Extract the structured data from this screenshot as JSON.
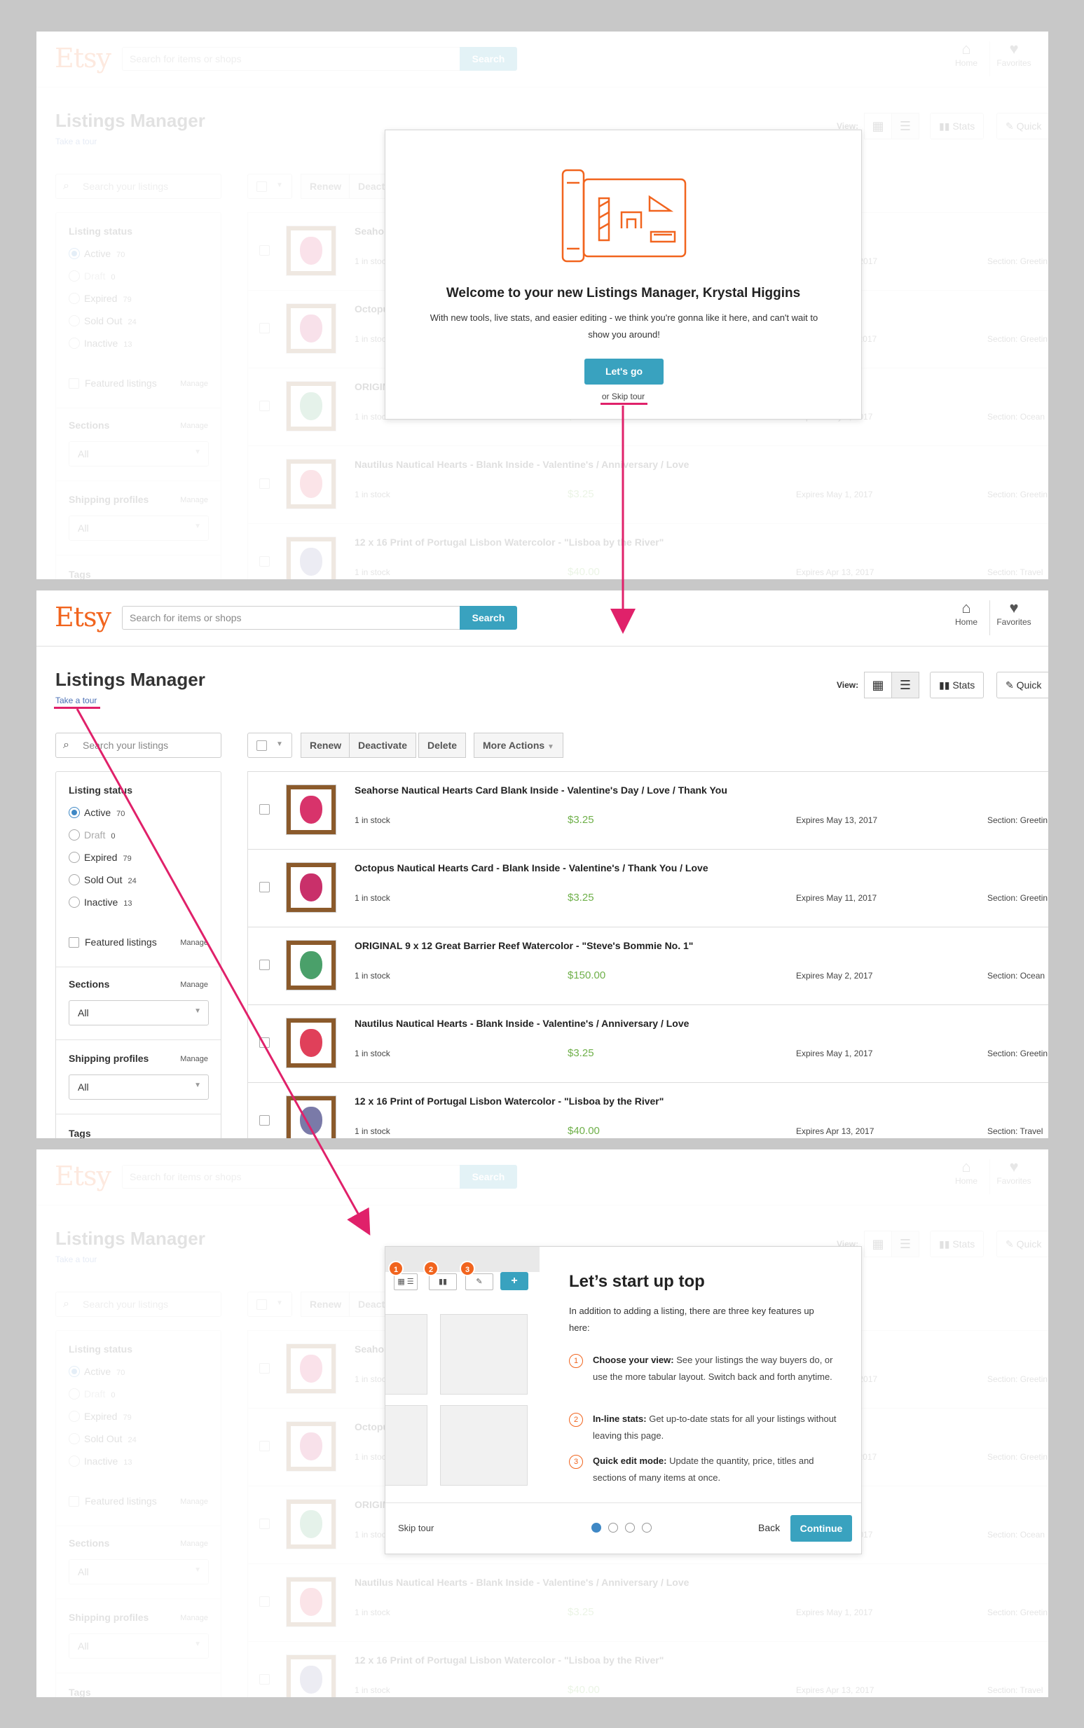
{
  "header": {
    "logo": "Etsy",
    "search_placeholder": "Search for items or shops",
    "search_button": "Search",
    "home_label": "Home",
    "favorites_label": "Favorites"
  },
  "page": {
    "title": "Listings Manager",
    "take_tour": "Take a tour",
    "view_label": "View:",
    "stats_label": "Stats",
    "quick_label": "Quick"
  },
  "sidebar": {
    "search_placeholder": "Search your listings",
    "status_heading": "Listing status",
    "statuses": [
      {
        "label": "Active",
        "count": "70"
      },
      {
        "label": "Draft",
        "count": "0"
      },
      {
        "label": "Expired",
        "count": "79"
      },
      {
        "label": "Sold Out",
        "count": "24"
      },
      {
        "label": "Inactive",
        "count": "13"
      }
    ],
    "featured_label": "Featured listings",
    "manage_label": "Manage",
    "sections_heading": "Sections",
    "sections_value": "All",
    "shipping_heading": "Shipping profiles",
    "shipping_value": "All",
    "tags_heading": "Tags"
  },
  "actions": {
    "renew": "Renew",
    "deactivate": "Deactivate",
    "delete": "Delete",
    "more": "More Actions"
  },
  "listings": [
    {
      "title": "Seahorse Nautical Hearts Card Blank Inside - Valentine's Day / Love / Thank You",
      "stock": "1 in stock",
      "price": "$3.25",
      "expires": "Expires May 13, 2017",
      "section": "Section: Greetin",
      "art_color": "#d8336b"
    },
    {
      "title": "Octopus Nautical Hearts Card - Blank Inside - Valentine's / Thank You / Love",
      "stock": "1 in stock",
      "price": "$3.25",
      "expires": "Expires May 11, 2017",
      "section": "Section: Greetin",
      "art_color": "#c9306a"
    },
    {
      "title": "ORIGINAL 9 x 12 Great Barrier Reef Watercolor - \"Steve's Bommie No. 1\"",
      "stock": "1 in stock",
      "price": "$150.00",
      "expires": "Expires May 2, 2017",
      "section": "Section: Ocean",
      "art_color": "#4aa06a"
    },
    {
      "title": "Nautilus Nautical Hearts - Blank Inside - Valentine's / Anniversary / Love",
      "stock": "1 in stock",
      "price": "$3.25",
      "expires": "Expires May 1, 2017",
      "section": "Section: Greetin",
      "art_color": "#e0405a"
    },
    {
      "title": "12 x 16 Print of Portugal Lisbon Watercolor - \"Lisboa by the River\"",
      "stock": "1 in stock",
      "price": "$40.00",
      "expires": "Expires Apr 13, 2017",
      "section": "Section: Travel",
      "art_color": "#7a7aa8"
    }
  ],
  "welcome": {
    "title": "Welcome to your new Listings Manager, Krystal Higgins",
    "body": "With new tools, live stats, and easier editing - we think you're gonna like it here, and can't wait to show you around!",
    "cta": "Let's go",
    "skip": "or Skip tour"
  },
  "step": {
    "title": "Let’s start up top",
    "intro": "In addition to adding a listing, there are three key features up here:",
    "features": [
      {
        "num": "1",
        "name": "Choose your view:",
        "text": "See your listings the way buyers do, or use the more tabular layout. Switch back and forth anytime."
      },
      {
        "num": "2",
        "name": "In-line stats:",
        "text": "Get up-to-date stats for all your listings without leaving this page."
      },
      {
        "num": "3",
        "name": "Quick edit mode:",
        "text": "Update the quantity, price, titles and sections of many items at once."
      }
    ],
    "skip": "Skip tour",
    "back": "Back",
    "continue": "Continue",
    "badges": [
      "1",
      "2",
      "3"
    ],
    "plus": "+"
  },
  "colors": {
    "brand": "#f1641e",
    "primary": "#39a2bf",
    "annotation": "#e0216a",
    "price": "#6fb04a"
  }
}
